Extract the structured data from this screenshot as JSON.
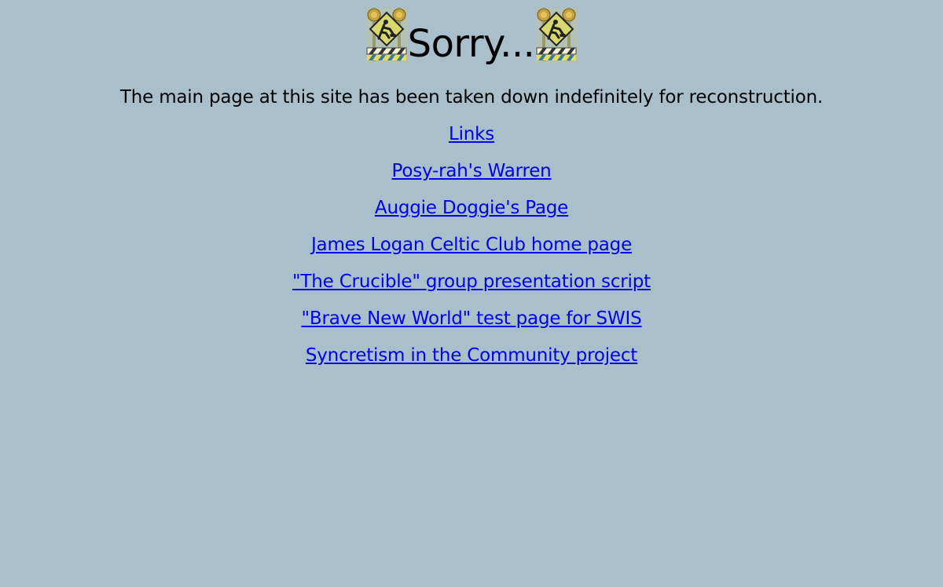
{
  "heading": {
    "text": "Sorry..."
  },
  "icons": {
    "left": "construction-sign",
    "right": "construction-sign"
  },
  "message": "The main page at this site has been taken down indefinitely for reconstruction.",
  "links": [
    {
      "label": "Links"
    },
    {
      "label": "Posy-rah's Warren"
    },
    {
      "label": "Auggie Doggie's Page"
    },
    {
      "label": "James Logan Celtic Club home page"
    },
    {
      "label": "\"The Crucible\" group presentation script"
    },
    {
      "label": "\"Brave New World\" test page for SWIS"
    },
    {
      "label": "Syncretism in the Community project"
    }
  ],
  "colors": {
    "background": "#a9bfcc",
    "link": "#0000ee"
  }
}
